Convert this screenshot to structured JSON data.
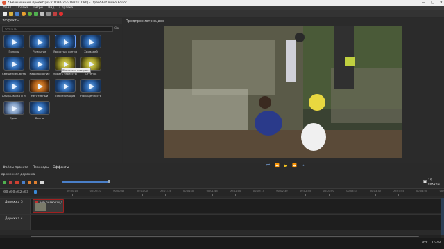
{
  "window": {
    "title": "* Безымянный проект [HEV 1080-25р 1920x1080] - OpenShot Video Editor",
    "min": "—",
    "max": "□",
    "close": "✕"
  },
  "menu": [
    "Файл",
    "Правка",
    "Титры",
    "Вид",
    "Справка"
  ],
  "toolbar": [
    "new-project",
    "open-project",
    "save-project",
    "undo",
    "redo",
    "import",
    "profile",
    "fullscreen",
    "export",
    "record"
  ],
  "effects": {
    "title": "Эффекты",
    "filter_placeholder": "Фильтр",
    "clear_label": "Ов",
    "tooltip": "Яркость и контраст",
    "items": [
      {
        "label": "Полосы",
        "style": ""
      },
      {
        "label": "Размытие",
        "style": ""
      },
      {
        "label": "Яркость и контраст",
        "style": ""
      },
      {
        "label": "Хромакей",
        "style": ""
      },
      {
        "label": "Смещение цвета",
        "style": ""
      },
      {
        "label": "Кадрирование",
        "style": ""
      },
      {
        "label": "Убрать чересстрочность",
        "style": "yellow"
      },
      {
        "label": "Оттенок",
        "style": "yellow"
      },
      {
        "label": "Альфа-маска и переходы",
        "style": ""
      },
      {
        "label": "Негативный",
        "style": "orange"
      },
      {
        "label": "Пикселизация",
        "style": ""
      },
      {
        "label": "Насыщенность",
        "style": ""
      },
      {
        "label": "Сдвиг",
        "style": "pale"
      },
      {
        "label": "Волна",
        "style": ""
      }
    ]
  },
  "preview": {
    "title": "Предпросмотр видео"
  },
  "bottom_tabs": [
    "Файлы проекта",
    "Переходы",
    "Эффекты"
  ],
  "timeline": {
    "label": "временная дорожка",
    "timecode": "00:00:02:03",
    "zoom_label": "15 секунд",
    "ticks": [
      "00:00:15",
      "00:00:30",
      "00:00:45",
      "00:01:00",
      "00:01:15",
      "00:01:30",
      "00:01:45",
      "00:02:00",
      "00:02:15",
      "00:02:30",
      "00:02:45",
      "00:03:00",
      "00:03:15",
      "00:03:30",
      "00:03:45",
      "00:04:00",
      "00:04:15"
    ],
    "tracks": [
      {
        "name": "Дорожка 5",
        "clip": "VID_20190614_1"
      },
      {
        "name": "Дорожка 4",
        "clip": ""
      }
    ]
  },
  "taskbar": {
    "lang": "РУС",
    "time": "16:48"
  }
}
